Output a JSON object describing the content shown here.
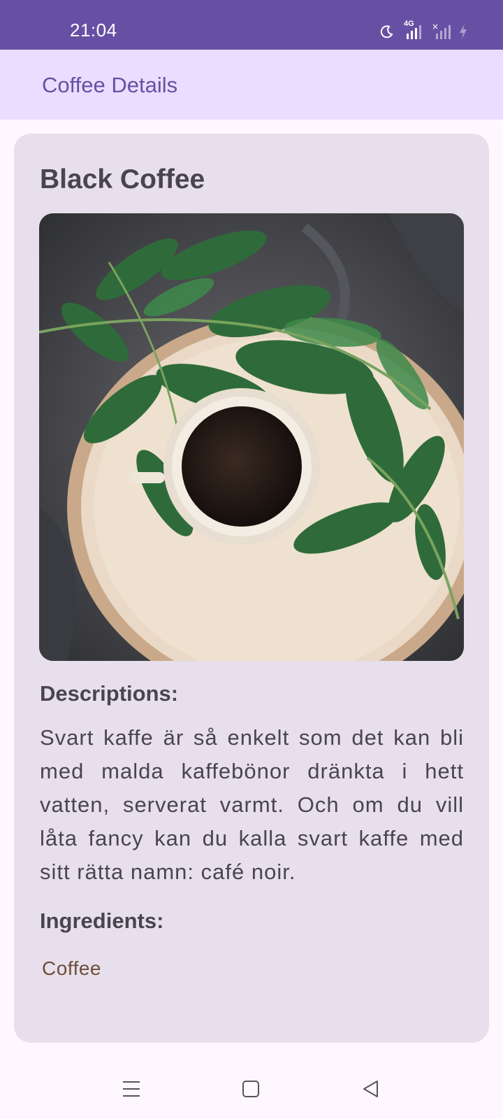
{
  "status_bar": {
    "time": "21:04",
    "network_label": "4G",
    "icons": [
      "moon-icon",
      "signal-4g-icon",
      "signal-icon",
      "battery-charging-icon"
    ],
    "background": "#6750A4"
  },
  "app_bar": {
    "title": "Coffee Details",
    "background": "#EADDFF",
    "title_color": "#6750A4"
  },
  "coffee": {
    "name": "Black Coffee",
    "image_alt": "Black coffee cup on a wooden tray with green leaves",
    "descriptions_label": "Descriptions:",
    "description": "Svart kaffe är så enkelt som det kan bli med malda kaffebönor dränkta i hett vatten, serverat varmt. Och om du vill låta fancy kan du kalla svart kaffe med sitt rätta namn: café noir.",
    "ingredients_label": "Ingredients:",
    "ingredients": [
      "Coffee"
    ]
  },
  "nav_bar": {
    "buttons": [
      "menu-icon",
      "home-icon",
      "back-icon"
    ]
  },
  "colors": {
    "card": "#E7E0EC",
    "text": "#49454F",
    "ingredient": "#6F4E37"
  }
}
